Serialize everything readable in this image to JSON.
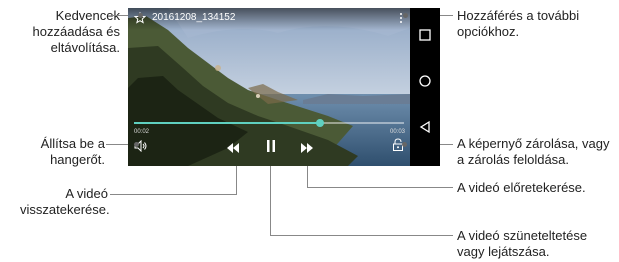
{
  "video": {
    "filename": "20161208_134152",
    "elapsed": "00:02",
    "duration": "00:03",
    "progress": 0.69
  },
  "callouts": {
    "favorites": "Kedvencek hozzáadása és eltávolítása.",
    "more_options": "Hozzáférés a további opciókhoz.",
    "volume": "Állítsa be a hangerőt.",
    "lock": "A képernyő zárolása, vagy a zárolás feloldása.",
    "rewind": "A videó visszatekerése.",
    "fast_forward": "A videó előretekerése.",
    "pause_play": "A videó szüneteltetése vagy lejátszása."
  },
  "colors": {
    "accent": "#5fd0c0",
    "leader_line": "#888888"
  },
  "icons": [
    "star-icon",
    "more-vert-icon",
    "volume-icon",
    "lock-icon",
    "rewind-icon",
    "pause-icon",
    "fast-forward-icon",
    "square-nav-icon",
    "circle-nav-icon",
    "back-nav-icon"
  ]
}
